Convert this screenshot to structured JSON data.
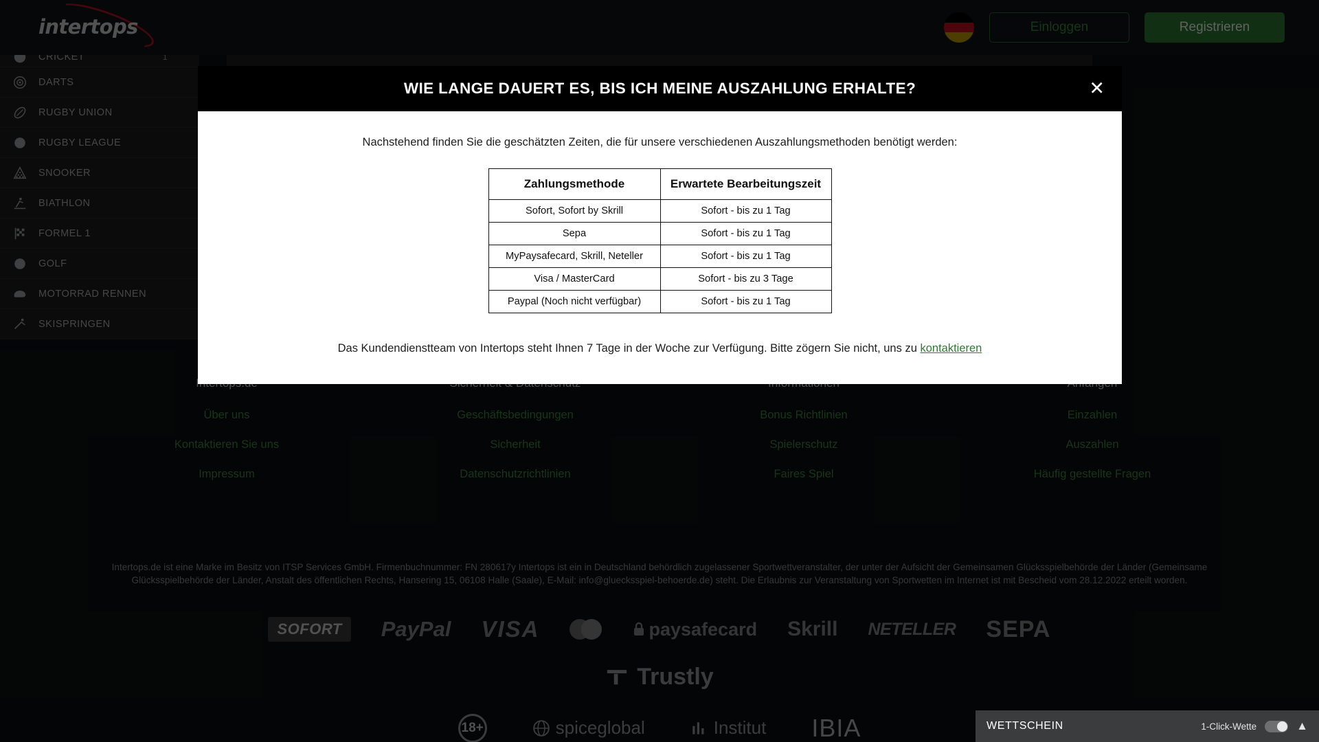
{
  "header": {
    "logo_text": "intertops",
    "flag_icon": "german-flag-icon",
    "login_label": "Einloggen",
    "register_label": "Registrieren"
  },
  "sidebar": {
    "items": [
      {
        "label": "CRICKET",
        "icon": "cricket-icon",
        "badge": "1"
      },
      {
        "label": "DARTS",
        "icon": "darts-target-icon",
        "badge": ""
      },
      {
        "label": "RUGBY UNION",
        "icon": "rugby-ball-icon",
        "badge": ""
      },
      {
        "label": "RUGBY LEAGUE",
        "icon": "rugby-league-icon",
        "badge": ""
      },
      {
        "label": "SNOOKER",
        "icon": "snooker-balls-icon",
        "badge": ""
      },
      {
        "label": "BIATHLON",
        "icon": "biathlon-skier-icon",
        "badge": ""
      },
      {
        "label": "FORMEL 1",
        "icon": "checkered-flag-icon",
        "badge": ""
      },
      {
        "label": "GOLF",
        "icon": "golf-ball-icon",
        "badge": ""
      },
      {
        "label": "MOTORRAD RENNEN",
        "icon": "motorcycle-helmet-icon",
        "badge": ""
      },
      {
        "label": "SKISPRINGEN",
        "icon": "ski-jumper-icon",
        "badge": ""
      }
    ]
  },
  "modal": {
    "title": "WIE LANGE DAUERT ES, BIS ICH MEINE AUSZAHLUNG ERHALTE?",
    "close_icon": "close-icon",
    "intro": "Nachstehend finden Sie die geschätzten Zeiten, die für unsere verschiedenen Auszahlungsmethoden benötigt werden:",
    "table": {
      "headers": [
        "Zahlungsmethode",
        "Erwartete Bearbeitungszeit"
      ],
      "rows": [
        [
          "Sofort, Sofort by Skrill",
          "Sofort - bis zu 1 Tag"
        ],
        [
          "Sepa",
          "Sofort - bis zu 1 Tag"
        ],
        [
          "MyPaysafecard, Skrill, Neteller",
          "Sofort - bis zu 1 Tag"
        ],
        [
          "Visa / MasterCard",
          "Sofort - bis zu 3 Tage"
        ],
        [
          "Paypal (Noch nicht verfügbar)",
          "Sofort - bis zu 1 Tag"
        ]
      ]
    },
    "footer_text": "Das Kundendienstteam von Intertops steht Ihnen 7 Tage in der Woche zur Verfügung. Bitte zögern Sie nicht, uns zu ",
    "footer_link": "kontaktieren"
  },
  "footer": {
    "columns": [
      {
        "heading": "Intertops.de",
        "links": [
          "Über uns",
          "Kontaktieren Sie uns",
          "Impressum"
        ]
      },
      {
        "heading": "Sicherheit & Datenschutz",
        "links": [
          "Geschäftsbedingungen",
          "Sicherheit",
          "Datenschutzrichtlinien"
        ]
      },
      {
        "heading": "Informationen",
        "links": [
          "Bonus Richtlinien",
          "Spielerschutz",
          "Faires Spiel"
        ]
      },
      {
        "heading": "Anfangen",
        "links": [
          "Einzahlen",
          "Auszahlen",
          "Häufig gestellte Fragen"
        ]
      }
    ],
    "legal": "Intertops.de ist eine Marke im Besitz von ITSP Services GmbH. Firmenbuchnummer: FN 280617y Intertops ist ein in Deutschland behördlich zugelassener Sportwettveranstalter, der unter der Aufsicht der Gemeinsamen Glücksspielbehörde der Länder (Gemeinsame Glücksspielbehörde der Länder, Anstalt des öffentlichen Rechts, Hansering 15, 06108 Halle (Saale), E-Mail: info@gluecksspiel-behoerde.de) steht. Die Erlaubnis zur Veranstaltung von Sportwetten im Internet ist mit Bescheid vom 28.12.2022 erteilt worden.",
    "payment_logos": [
      "SOFORT",
      "PayPal",
      "VISA",
      "mastercard",
      "paysafecard",
      "Skrill",
      "NETELLER",
      "SEPA"
    ],
    "trustly_logo": "Trustly",
    "badges": [
      "18+",
      "spiceglobal",
      "Institut",
      "IBIA"
    ]
  },
  "betslip": {
    "title": "WETTSCHEIN",
    "one_click_label": "1-Click-Wette",
    "toggle_state": "on",
    "chevron_icon": "chevron-up-icon"
  },
  "colors": {
    "brand_green": "#2e7d32",
    "link_green": "#3d8b41",
    "logo_red": "#b01725",
    "page_bg": "#0d0f11",
    "sidebar_bg": "#1d1f21"
  }
}
